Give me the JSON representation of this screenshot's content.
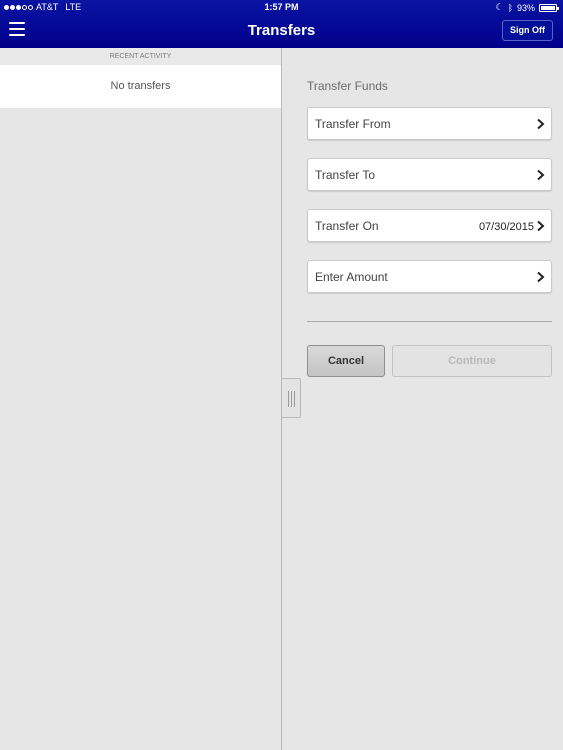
{
  "status_bar": {
    "carrier": "AT&T",
    "network": "LTE",
    "time": "1:57 PM",
    "battery_percent": "93%",
    "signal_bars": 3,
    "signal_total": 5
  },
  "header": {
    "title": "Transfers",
    "menu_icon": "hamburger-menu-icon",
    "sign_off_label": "Sign Off"
  },
  "left_panel": {
    "section_header": "RECENT ACTIVITY",
    "empty_message": "No transfers"
  },
  "right_panel": {
    "section_title": "Transfer Funds",
    "fields": [
      {
        "label": "Transfer From",
        "value": ""
      },
      {
        "label": "Transfer To",
        "value": ""
      },
      {
        "label": "Transfer On",
        "value": "07/30/2015"
      },
      {
        "label": "Enter Amount",
        "value": ""
      }
    ],
    "cancel_label": "Cancel",
    "continue_label": "Continue"
  },
  "colors": {
    "header_blue": "#00008a",
    "background": "#e6e6e6",
    "disabled_text": "#b8b8b8"
  }
}
